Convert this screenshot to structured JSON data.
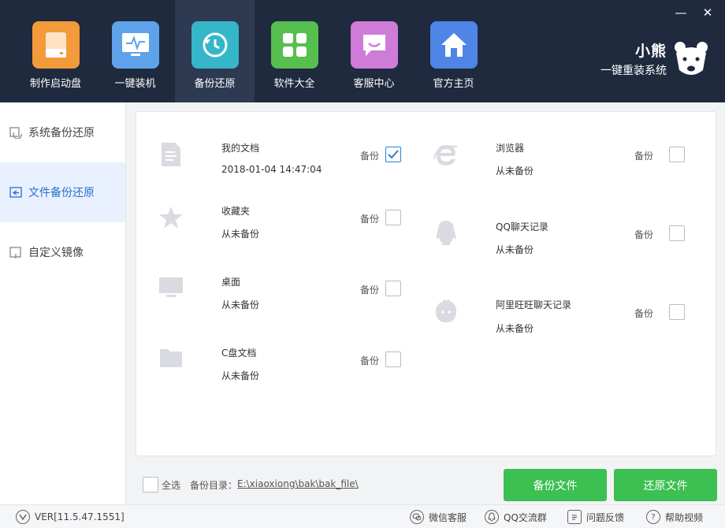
{
  "window": {
    "minimize_label": "—",
    "close_label": "✕"
  },
  "nav": [
    {
      "label": "制作启动盘",
      "icon": "usb-drive-icon",
      "color": "#f39a3a"
    },
    {
      "label": "一键装机",
      "icon": "monitor-pulse-icon",
      "color": "#5ea3ea"
    },
    {
      "label": "备份还原",
      "icon": "restore-icon",
      "color": "#35b6c9",
      "active": true
    },
    {
      "label": "软件大全",
      "icon": "apps-grid-icon",
      "color": "#56bf4f"
    },
    {
      "label": "客服中心",
      "icon": "chat-bubble-icon",
      "color": "#cf7bd8"
    },
    {
      "label": "官方主页",
      "icon": "home-icon",
      "color": "#4f85e6"
    }
  ],
  "brand": {
    "name": "小熊",
    "subtitle": "一键重装系统"
  },
  "sidebar": [
    {
      "label": "系统备份还原",
      "icon": "system-backup-icon"
    },
    {
      "label": "文件备份还原",
      "icon": "file-backup-icon",
      "active": true
    },
    {
      "label": "自定义镜像",
      "icon": "custom-image-icon"
    }
  ],
  "backup_label": "备份",
  "entries_left": [
    {
      "title": "我的文档",
      "status": "2018-01-04 14:47:04",
      "icon": "document-icon",
      "checked": true
    },
    {
      "title": "收藏夹",
      "status": "从未备份",
      "icon": "star-icon",
      "checked": false
    },
    {
      "title": "桌面",
      "status": "从未备份",
      "icon": "desktop-icon",
      "checked": false
    },
    {
      "title": "C盘文档",
      "status": "从未备份",
      "icon": "folder-icon",
      "checked": false
    }
  ],
  "entries_right": [
    {
      "title": "浏览器",
      "status": "从未备份",
      "icon": "browser-icon",
      "checked": false
    },
    {
      "title": "QQ聊天记录",
      "status": "从未备份",
      "icon": "qq-penguin-icon",
      "checked": false
    },
    {
      "title": "阿里旺旺聊天记录",
      "status": "从未备份",
      "icon": "wangwang-icon",
      "checked": false
    }
  ],
  "bottom": {
    "select_all_label": "全选",
    "dir_label": "备份目录：",
    "dir_path": "E:\\xiaoxiong\\bak\\bak_file\\",
    "backup_button": "备份文件",
    "restore_button": "还原文件"
  },
  "status": {
    "version": "VER[11.5.47.1551]",
    "links": [
      {
        "label": "微信客服",
        "icon": "wechat-icon"
      },
      {
        "label": "QQ交流群",
        "icon": "qq-icon"
      },
      {
        "label": "问题反馈",
        "icon": "feedback-icon"
      },
      {
        "label": "帮助视频",
        "icon": "help-icon"
      }
    ]
  }
}
